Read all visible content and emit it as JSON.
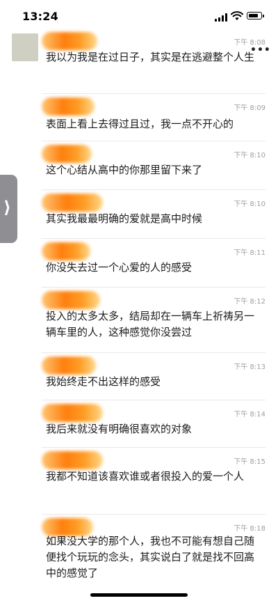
{
  "status_bar": {
    "time": "13:24"
  },
  "messages": [
    {
      "time": "下午 8:08",
      "text": "我以为我是在过日子，其实是在逃避整个人生"
    },
    {
      "time": "下午 8:09",
      "text": "表面上看上去得过且过，我一点不开心的"
    },
    {
      "time": "下午 8:10",
      "text": "这个心结从高中的你那里留下来了"
    },
    {
      "time": "下午 8:10",
      "text": "其实我最最明确的爱就是高中时候"
    },
    {
      "time": "下午 8:11",
      "text": "你没失去过一个心爱的人的感受"
    },
    {
      "time": "下午 8:12",
      "text": "投入的太多太多，结局却在一辆车上祈祷另一辆车里的人，这种感觉你没尝过"
    },
    {
      "time": "下午 8:13",
      "text": "我始终走不出这样的感受"
    },
    {
      "time": "下午 8:14",
      "text": "我后来就没有明确很喜欢的对象"
    },
    {
      "time": "下午 8:15",
      "text": "我都不知道该喜欢谁或者很投入的爱一个人"
    },
    {
      "time": "下午 8:18",
      "text": "如果没大学的那个人，我也不可能有想自己随便找个玩玩的念头，其实说白了就是找不回高中的感觉了"
    }
  ],
  "icons": {
    "more": "more-icon",
    "side_tab": "chevron-right-icon"
  },
  "colors": {
    "redaction": "#ff8a00",
    "timestamp": "#9e9e9e",
    "side_tab": "#8e8e93"
  }
}
